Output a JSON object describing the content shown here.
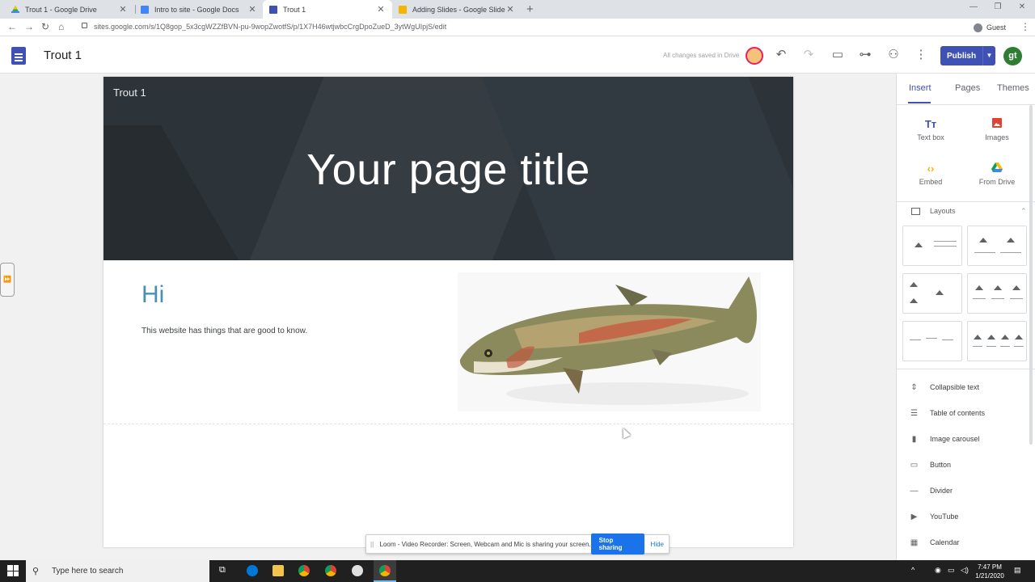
{
  "browser": {
    "tabs": [
      {
        "title": "Trout 1 - Google Drive",
        "icon": "google-drive-icon",
        "color": "#34a853"
      },
      {
        "title": "Intro to site - Google Docs",
        "icon": "google-docs-icon",
        "color": "#4285f4"
      },
      {
        "title": "Trout 1",
        "icon": "google-sites-icon",
        "color": "#3f51b5"
      },
      {
        "title": "Adding Slides - Google Slides",
        "icon": "google-slides-icon",
        "color": "#f4b400"
      }
    ],
    "url": "sites.google.com/s/1Q8gop_5x3cgWZZfBVN-pu-9wopZwotfS/p/1X7H46wtjwbcCrgDpoZueD_3ytWgUIpjS/edit",
    "profile_label": "Guest"
  },
  "sites": {
    "doc_title": "Trout 1",
    "save_status": "All changes saved in Drive",
    "publish_label": "Publish",
    "account_initials": "gt",
    "accent": "#3f51b5"
  },
  "page": {
    "site_name": "Trout 1",
    "title": "Your page title",
    "heading": "Hi",
    "body": "This website has things that are good to know."
  },
  "panel": {
    "tabs": [
      "Insert",
      "Pages",
      "Themes"
    ],
    "insert_items": [
      {
        "label": "Text box",
        "icon": "text-box-icon",
        "glyph": "Tт",
        "color": "#3f51b5"
      },
      {
        "label": "Images",
        "icon": "images-icon",
        "glyph": "▣",
        "color": "#db4437"
      },
      {
        "label": "Embed",
        "icon": "embed-icon",
        "glyph": "‹›",
        "color": "#f4b400"
      },
      {
        "label": "From Drive",
        "icon": "drive-icon",
        "glyph": "▲",
        "color": "#0f9d58"
      }
    ],
    "layouts_label": "Layouts",
    "components": [
      {
        "label": "Collapsible text",
        "icon": "collapsible-text-icon",
        "glyph": "⇕"
      },
      {
        "label": "Table of contents",
        "icon": "table-of-contents-icon",
        "glyph": "☰"
      },
      {
        "label": "Image carousel",
        "icon": "image-carousel-icon",
        "glyph": "▮"
      },
      {
        "label": "Button",
        "icon": "button-icon",
        "glyph": "▭"
      },
      {
        "label": "Divider",
        "icon": "divider-icon",
        "glyph": "—"
      },
      {
        "label": "YouTube",
        "icon": "youtube-icon",
        "glyph": "▶"
      },
      {
        "label": "Calendar",
        "icon": "calendar-icon",
        "glyph": "▦"
      }
    ]
  },
  "loom": {
    "message": "Loom - Video Recorder: Screen, Webcam and Mic is sharing your screen.",
    "stop_label": "Stop sharing",
    "hide_label": "Hide"
  },
  "taskbar": {
    "search_placeholder": "Type here to search",
    "time": "7:47 PM",
    "date": "1/21/2020"
  }
}
